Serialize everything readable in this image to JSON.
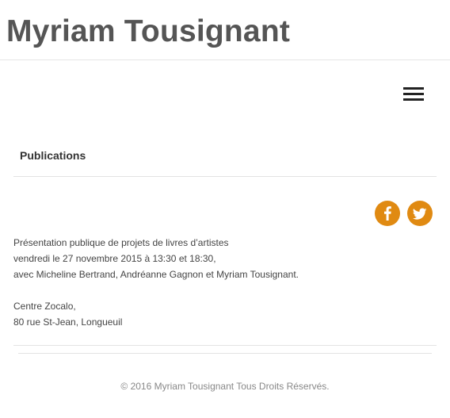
{
  "header": {
    "site_title": "Myriam Tousignant",
    "menu_icon": "hamburger-menu-icon"
  },
  "content": {
    "heading": "Publications",
    "social": {
      "facebook_icon": "facebook-icon",
      "twitter_icon": "twitter-icon",
      "accent_color": "#e08a12"
    },
    "lines": [
      "Présentation publique de projets de livres d’artistes",
      "vendredi le 27 novembre 2015 à 13:30 et 18:30,",
      "avec Micheline Bertrand, Andréanne Gagnon et Myriam Tousignant.",
      "Centre Zocalo,",
      "80 rue St-Jean, Longueuil"
    ]
  },
  "footer": {
    "copyright": "© 2016 Myriam Tousignant Tous Droits Réservés."
  }
}
